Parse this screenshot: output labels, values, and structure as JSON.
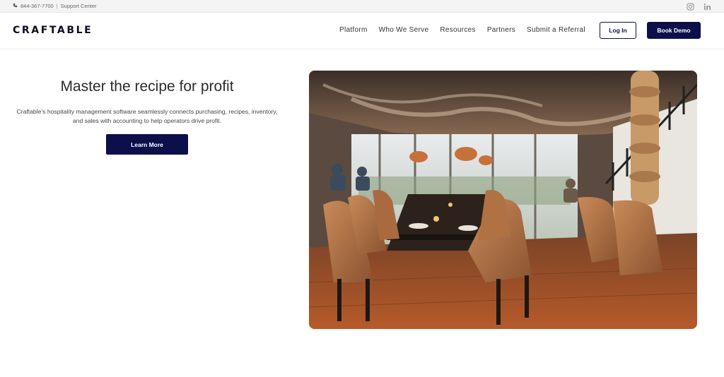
{
  "topbar": {
    "phone": "844-367-7700",
    "separator": "|",
    "support": "Support Center",
    "social_icons": [
      "instagram-icon",
      "linkedin-icon"
    ]
  },
  "header": {
    "logo": "CRAFTABLE",
    "nav": [
      "Platform",
      "Who We Serve",
      "Resources",
      "Partners",
      "Submit a Referral"
    ],
    "login_label": "Log In",
    "demo_label": "Book Demo"
  },
  "hero": {
    "title": "Master the recipe for profit",
    "description": "Craftable’s hospitality management software seamlessly connects purchasing, recipes, inventory, and sales with accounting to help operators drive profit.",
    "cta_label": "Learn More"
  },
  "colors": {
    "brand_navy": "#0c0f4a",
    "topbar_bg": "#f4f4f4"
  }
}
